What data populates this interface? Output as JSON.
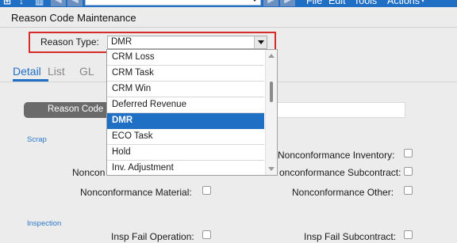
{
  "toolbar": {
    "menu": [
      "File",
      "Edit",
      "Tools",
      "Actions"
    ],
    "icons": [
      "layout-icon",
      "nav-icon",
      "grid-icon"
    ]
  },
  "window": {
    "title": "Reason Code Maintenance"
  },
  "reason_type": {
    "label": "Reason Type:",
    "value": "DMR"
  },
  "tabs": [
    "Detail",
    "List",
    "GL"
  ],
  "detail": {
    "reason_code_label": "Reason Code",
    "scrap": {
      "title": "Scrap",
      "nonconf_prefix": "Noncon",
      "nonconformance_inventory": "Nonconformance Inventory:",
      "nonconformance_subcontract": "onconformance Subcontract:",
      "nonconformance_material": "Nonconformance Material:",
      "nonconformance_other": "Nonconformance Other:"
    },
    "inspection": {
      "title": "Inspection",
      "insp_fail_operation": "Insp Fail Operation:",
      "insp_fail_subcontract": "Insp Fail Subcontract:"
    }
  },
  "dropdown": {
    "options": [
      "CRM Loss",
      "CRM Task",
      "CRM Win",
      "Deferred Revenue",
      "DMR",
      "ECO Task",
      "Hold",
      "Inv.  Adjustment"
    ],
    "selected": "DMR"
  }
}
